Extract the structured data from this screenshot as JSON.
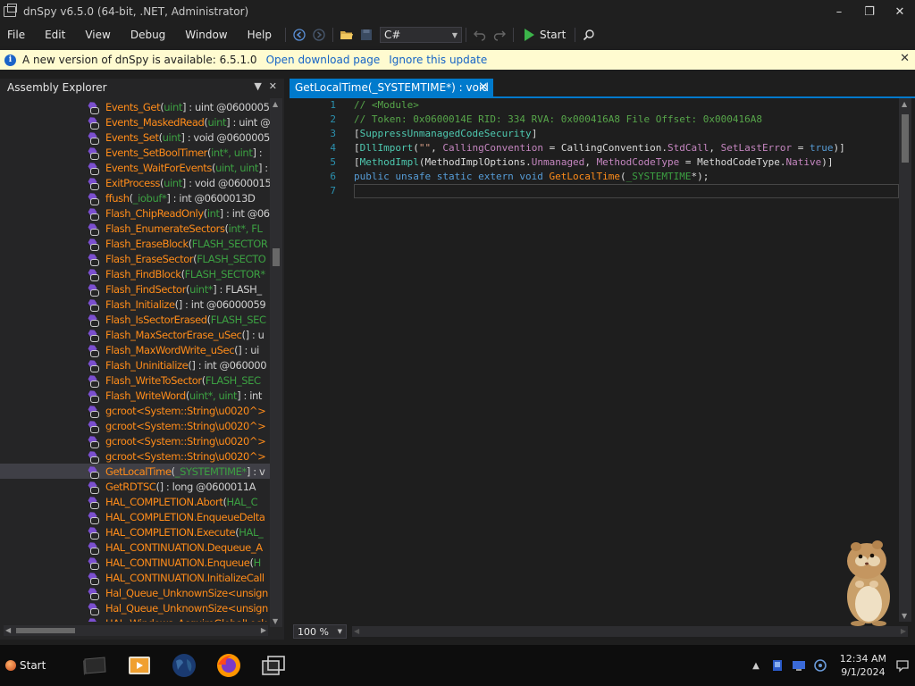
{
  "window": {
    "title": "dnSpy v6.5.0 (64-bit, .NET, Administrator)",
    "minimize": "–",
    "restore": "❐",
    "close": "✕"
  },
  "menu": {
    "items": [
      "File",
      "Edit",
      "View",
      "Debug",
      "Window",
      "Help"
    ]
  },
  "toolbar": {
    "language": "C#",
    "start_label": "Start"
  },
  "infobar": {
    "message": "A new version of dnSpy is available: 6.5.1.0",
    "open_link": "Open download page",
    "ignore_link": "Ignore this update",
    "close": "✕"
  },
  "assembly_explorer": {
    "title": "Assembly Explorer",
    "items": [
      {
        "name": "Events_Get",
        "params": "uint",
        "ret": "] : uint @0600005"
      },
      {
        "name": "Events_MaskedRead",
        "params": "uint",
        "ret": "] : uint @"
      },
      {
        "name": "Events_Set",
        "params": "uint",
        "ret": "] : void @0600005"
      },
      {
        "name": "Events_SetBoolTimer",
        "params": "int*, uint",
        "ret": "] :"
      },
      {
        "name": "Events_WaitForEvents",
        "params": "uint, uint",
        "ret": "] :"
      },
      {
        "name": "ExitProcess",
        "params": "uint",
        "ret": "] : void @0600015"
      },
      {
        "name": "ffush",
        "params": "_iobuf*",
        "ret": "] : int @0600013D"
      },
      {
        "name": "Flash_ChipReadOnly",
        "params": "int",
        "ret": "] : int @06"
      },
      {
        "name": "Flash_EnumerateSectors",
        "params": "int*, FL",
        "ret": ""
      },
      {
        "name": "Flash_EraseBlock",
        "params": "FLASH_SECTOR",
        "ret": ""
      },
      {
        "name": "Flash_EraseSector",
        "params": "FLASH_SECTO",
        "ret": ""
      },
      {
        "name": "Flash_FindBlock",
        "params": "FLASH_SECTOR*",
        "ret": ""
      },
      {
        "name": "Flash_FindSector",
        "params": "uint*",
        "ret": "] : FLASH_"
      },
      {
        "name": "Flash_Initialize",
        "params": "",
        "ret": "] : int @06000059"
      },
      {
        "name": "Flash_IsSectorErased",
        "params": "FLASH_SEC",
        "ret": ""
      },
      {
        "name": "Flash_MaxSectorErase_uSec",
        "params": "",
        "ret": "] : u"
      },
      {
        "name": "Flash_MaxWordWrite_uSec",
        "params": "",
        "ret": "] : ui"
      },
      {
        "name": "Flash_Uninitialize",
        "params": "",
        "ret": "] : int @060000"
      },
      {
        "name": "Flash_WriteToSector",
        "params": "FLASH_SEC",
        "ret": ""
      },
      {
        "name": "Flash_WriteWord",
        "params": "uint*, uint",
        "ret": "] : int"
      },
      {
        "name": "gcroot<System::String\\u0020^>",
        "params": "",
        "ret": ""
      },
      {
        "name": "gcroot<System::String\\u0020^>",
        "params": "",
        "ret": ""
      },
      {
        "name": "gcroot<System::String\\u0020^>",
        "params": "",
        "ret": ""
      },
      {
        "name": "gcroot<System::String\\u0020^>",
        "params": "",
        "ret": ""
      },
      {
        "name": "GetLocalTime",
        "params": "_SYSTEMTIME*",
        "ret": "] : v",
        "selected": true
      },
      {
        "name": "GetRDTSC",
        "params": "",
        "ret": "] : long @0600011A"
      },
      {
        "name": "HAL_COMPLETION.Abort",
        "params": "HAL_C",
        "ret": ""
      },
      {
        "name": "HAL_COMPLETION.EnqueueDelta",
        "params": "",
        "ret": ""
      },
      {
        "name": "HAL_COMPLETION.Execute",
        "params": "HAL_",
        "ret": ""
      },
      {
        "name": "HAL_CONTINUATION.Dequeue_A",
        "params": "",
        "ret": ""
      },
      {
        "name": "HAL_CONTINUATION.Enqueue",
        "params": "H",
        "ret": ""
      },
      {
        "name": "HAL_CONTINUATION.InitializeCall",
        "params": "",
        "ret": ""
      },
      {
        "name": "Hal_Queue_UnknownSize<unsign",
        "params": "",
        "ret": ""
      },
      {
        "name": "Hal_Queue_UnknownSize<unsign",
        "params": "",
        "ret": ""
      },
      {
        "name": "HAL_Windows_AcquireGlobalLock",
        "params": "",
        "ret": ""
      }
    ]
  },
  "editor": {
    "tab_title": "GetLocalTime(_SYSTEMTIME*) : void",
    "tab_close": "✕",
    "line_numbers": [
      "1",
      "2",
      "3",
      "4",
      "5",
      "6",
      "7"
    ],
    "code": {
      "l1": "// <Module>",
      "l2": "// Token: 0x0600014E RID: 334 RVA: 0x000416A8 File Offset: 0x000416A8",
      "l3_open": "[",
      "l3_attr": "SuppressUnmanagedCodeSecurity",
      "l3_close": "]",
      "l4_open": "[",
      "l4_attr": "DllImport",
      "l4_a": "(",
      "l4_str": "\"\"",
      "l4_b": ", ",
      "l4_prop1": "CallingConvention",
      "l4_c": " = ",
      "l4_enum1": "CallingConvention",
      "l4_d": ".",
      "l4_val1": "StdCall",
      "l4_e": ", ",
      "l4_prop2": "SetLastError",
      "l4_f": " = ",
      "l4_kw": "true",
      "l4_g": ")]",
      "l5_open": "[",
      "l5_attr": "MethodImpl",
      "l5_a": "(",
      "l5_enum1": "MethodImplOptions",
      "l5_b": ".",
      "l5_val1": "Unmanaged",
      "l5_c": ", ",
      "l5_prop": "MethodCodeType",
      "l5_d": " = ",
      "l5_enum2": "MethodCodeType",
      "l5_e": ".",
      "l5_val2": "Native",
      "l5_f": ")]",
      "l6_kw": "public unsafe static extern void ",
      "l6_method": "GetLocalTime",
      "l6_a": "(",
      "l6_param": "_SYSTEMTIME",
      "l6_b": "*);"
    },
    "zoom": "100 %"
  },
  "taskbar": {
    "start": "Start",
    "time": "12:34 AM",
    "date": "9/1/2024"
  }
}
